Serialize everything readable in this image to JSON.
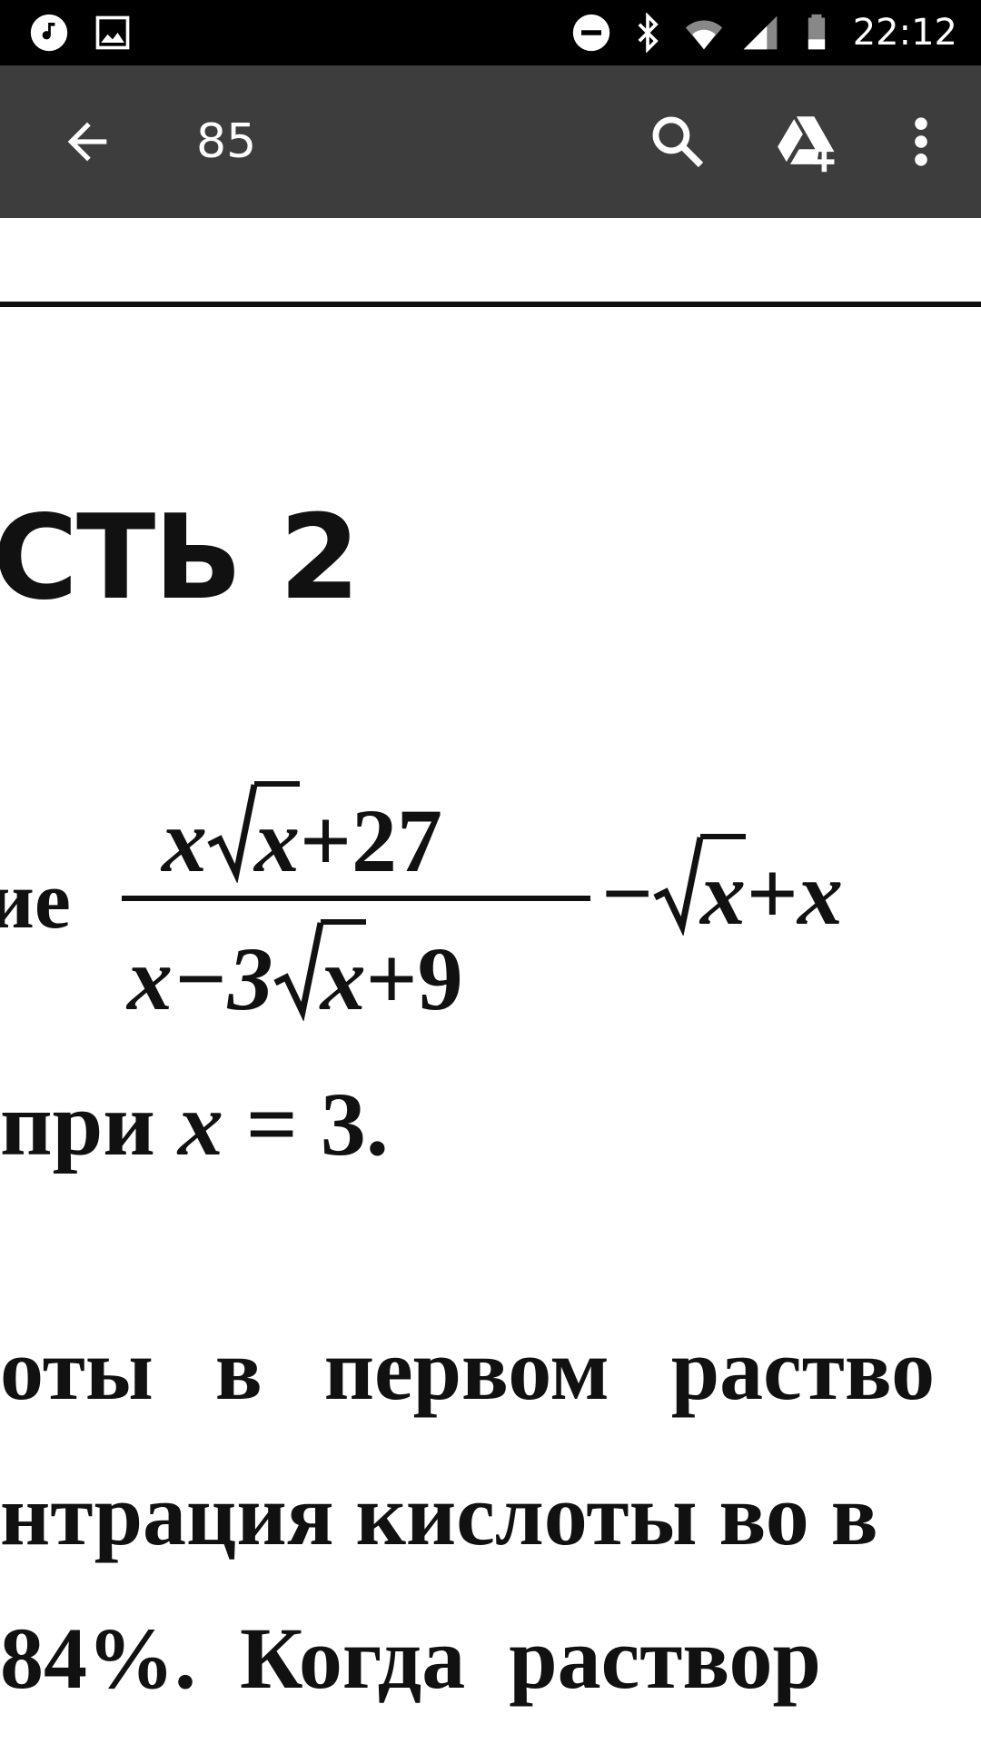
{
  "status_bar": {
    "time": "22:12",
    "left_icons": [
      "music-note-icon",
      "image-icon"
    ],
    "right_icons": [
      "do-not-disturb-icon",
      "bluetooth-icon",
      "wifi-icon",
      "cellular-signal-icon",
      "battery-icon"
    ]
  },
  "app_bar": {
    "title": "85",
    "icons": [
      "back-arrow-icon",
      "search-icon",
      "drive-add-icon",
      "more-vert-icon"
    ]
  },
  "document": {
    "section_title": "СТЬ 2",
    "fragment_ne": "ие",
    "numerator": {
      "a": "x",
      "sqrt": "x",
      "rest": "+27"
    },
    "denominator": {
      "a": "x−3",
      "sqrt": "x",
      "rest": "+9"
    },
    "tail": {
      "minus": "−",
      "sqrt": "x",
      "rest": "+x"
    },
    "condition": {
      "text": "при ",
      "var": "x",
      "rest": " = 3."
    },
    "lines": [
      "оты в первом раство",
      "нтрация кислоты во в",
      "84%. Когда раствор"
    ]
  }
}
